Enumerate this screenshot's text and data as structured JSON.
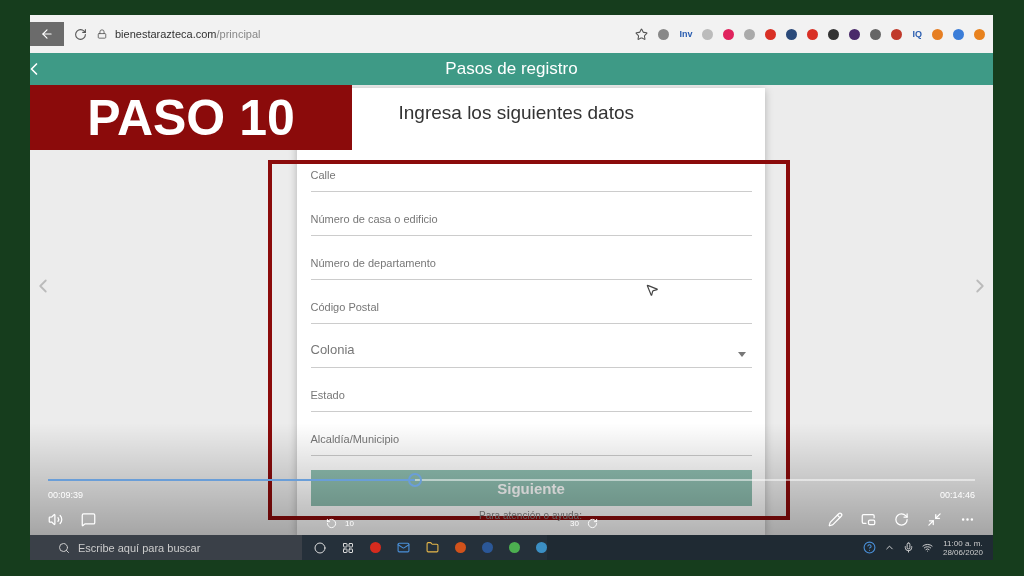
{
  "browser": {
    "url_host": "bienestarazteca.com",
    "url_path": "/principal",
    "extensions": [
      {
        "kind": "icon",
        "color": "#888888"
      },
      {
        "kind": "text",
        "label": "Inv"
      },
      {
        "kind": "icon",
        "color": "#bbbbbb"
      },
      {
        "kind": "icon",
        "color": "#e0245e"
      },
      {
        "kind": "icon",
        "color": "#aaaaaa"
      },
      {
        "kind": "icon",
        "color": "#d93025"
      },
      {
        "kind": "icon",
        "color": "#2b4a7a"
      },
      {
        "kind": "icon",
        "color": "#d93025"
      },
      {
        "kind": "icon",
        "color": "#333333"
      },
      {
        "kind": "icon",
        "color": "#4a2a6a"
      },
      {
        "kind": "icon",
        "color": "#666666"
      },
      {
        "kind": "icon",
        "color": "#c0392b"
      },
      {
        "kind": "text",
        "label": "IQ"
      },
      {
        "kind": "icon",
        "color": "#e67e22"
      },
      {
        "kind": "icon",
        "color": "#3b7dd8"
      },
      {
        "kind": "icon",
        "color": "#e8821e"
      }
    ]
  },
  "header": {
    "title": "Pasos de registro"
  },
  "badge": {
    "label": "PASO 10"
  },
  "card": {
    "title": "Ingresa los siguientes datos",
    "fields": [
      {
        "kind": "text",
        "placeholder": "Calle"
      },
      {
        "kind": "text",
        "placeholder": "Número de casa o edificio"
      },
      {
        "kind": "text",
        "placeholder": "Número de departamento"
      },
      {
        "kind": "text",
        "placeholder": "Código Postal"
      },
      {
        "kind": "select",
        "placeholder": "Colonia"
      },
      {
        "kind": "text",
        "placeholder": "Estado"
      },
      {
        "kind": "text",
        "placeholder": "Alcaldía/Municipio"
      }
    ],
    "button": "Siguiente",
    "help": "Para atención o ayuda:"
  },
  "player": {
    "elapsed": "00:09:39",
    "total": "00:14:46",
    "level": 0.396,
    "skip_back": "10",
    "skip_forward": "30"
  },
  "taskbar": {
    "search_placeholder": "Escribe aquí para buscar",
    "time": "11:00 a. m.",
    "date": "28/06/2020"
  }
}
